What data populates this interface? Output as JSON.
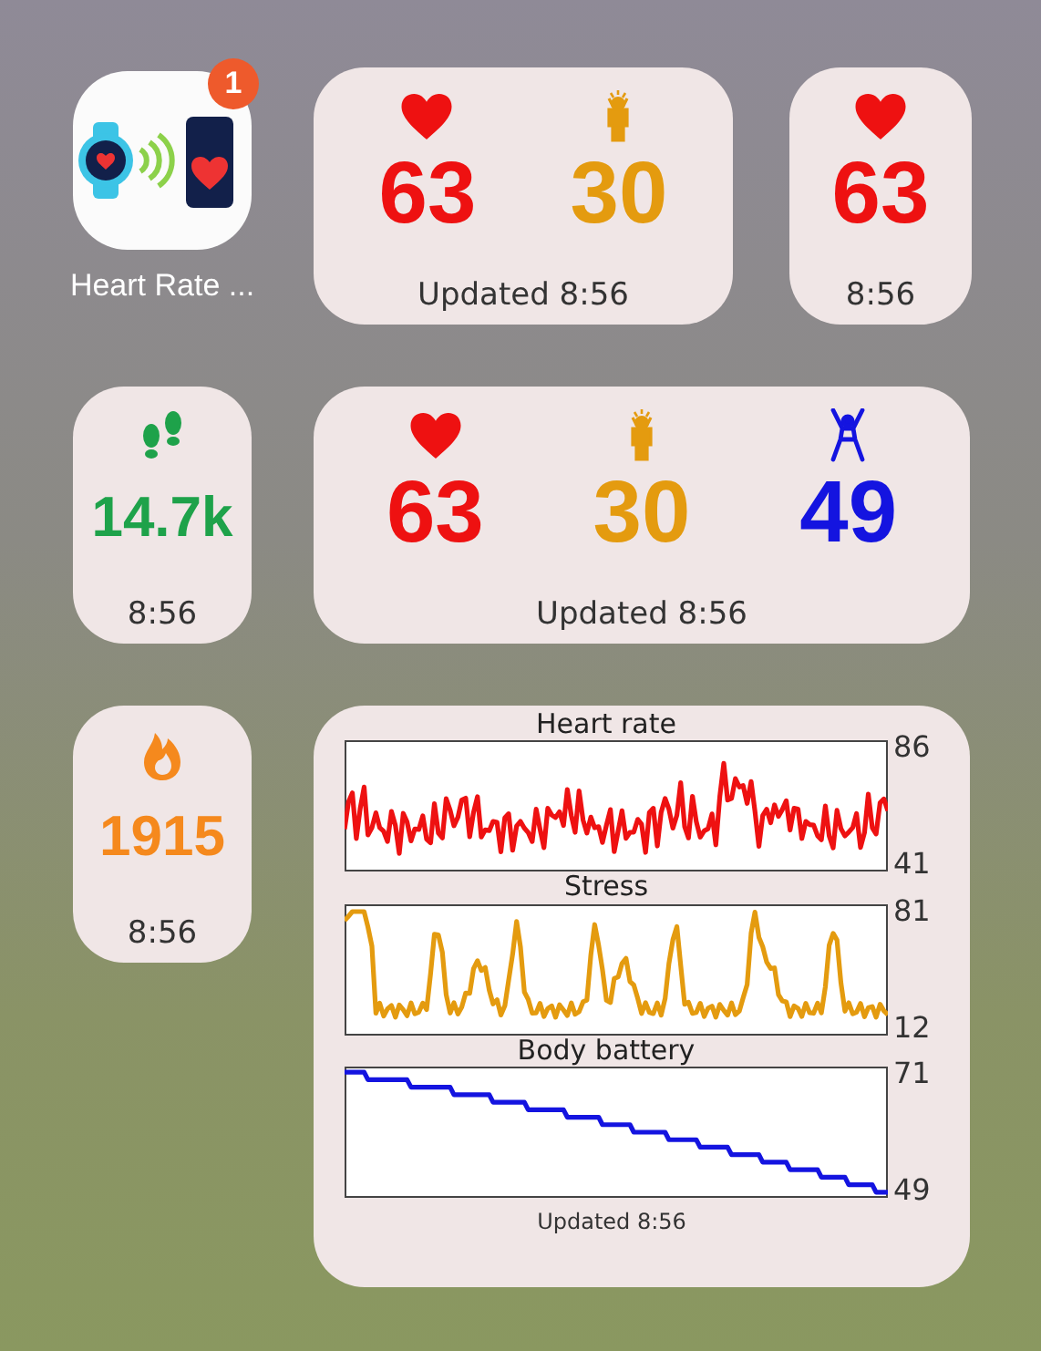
{
  "rows": [
    {
      "items": [
        {
          "kind": "app",
          "label": "Heart Rate ...",
          "badge": "1"
        },
        {
          "kind": "metrics",
          "metrics": [
            {
              "kind": "heart",
              "value": "63"
            },
            {
              "kind": "stress",
              "value": "30"
            }
          ],
          "footer": "Updated 8:56"
        },
        {
          "kind": "metrics",
          "metrics": [
            {
              "kind": "heart",
              "value": "63"
            }
          ],
          "footer": "8:56"
        }
      ]
    },
    {
      "items": [
        {
          "kind": "metrics",
          "metrics": [
            {
              "kind": "steps",
              "value": "14.7k"
            }
          ],
          "footer": "8:56"
        },
        {
          "kind": "metrics",
          "metrics": [
            {
              "kind": "heart",
              "value": "63"
            },
            {
              "kind": "stress",
              "value": "30"
            },
            {
              "kind": "battery",
              "value": "49"
            }
          ],
          "footer": "Updated 8:56"
        }
      ]
    },
    {
      "items": [
        {
          "kind": "metrics",
          "metrics": [
            {
              "kind": "calories",
              "value": "1915"
            }
          ],
          "footer": "8:56"
        },
        {
          "kind": "charts",
          "charts": [
            {
              "kind": "heart",
              "title": "Heart rate",
              "max_label": "86",
              "min_label": "41"
            },
            {
              "kind": "stress",
              "title": "Stress",
              "max_label": "81",
              "min_label": "12"
            },
            {
              "kind": "battery",
              "title": "Body battery",
              "max_label": "71",
              "min_label": "49"
            }
          ],
          "footer": "Updated 8:56"
        }
      ]
    }
  ]
}
